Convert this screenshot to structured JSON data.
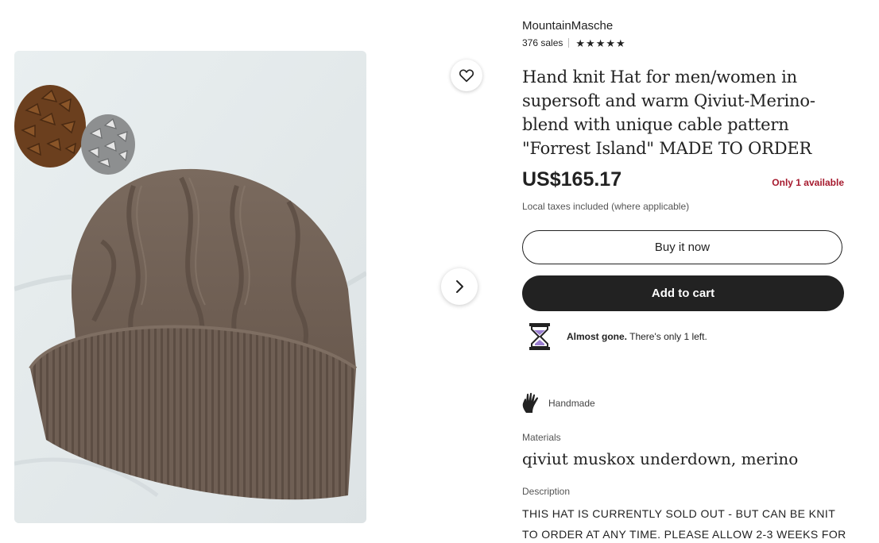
{
  "shop": {
    "name": "MountainMasche",
    "sales": "376 sales",
    "rating_stars": 5
  },
  "listing": {
    "title": "Hand knit Hat for men/women in supersoft and warm Qiviut-Merino-blend with unique cable pattern \"Forrest Island\" MADE TO ORDER",
    "price": "US$165.17",
    "availability": "Only 1 available",
    "tax_note": "Local taxes included (where applicable)"
  },
  "actions": {
    "buy_now_label": "Buy it now",
    "add_to_cart_label": "Add to cart",
    "favorite_icon": "heart-icon",
    "next_icon": "chevron-right-icon"
  },
  "scarcity": {
    "strong": "Almost gone.",
    "text": " There's only 1 left.",
    "icon": "hourglass-icon"
  },
  "highlights": {
    "handmade_label": "Handmade",
    "handmade_icon": "hand-icon"
  },
  "details": {
    "materials_label": "Materials",
    "materials_value": "qiviut muskox underdown, merino",
    "description_label": "Description",
    "description_text": "THIS HAT IS CURRENTLY SOLD OUT - BUT CAN BE KNIT TO ORDER AT ANY TIME. PLEASE ALLOW 2-3 WEEKS FOR"
  },
  "colors": {
    "text": "#222222",
    "availability": "#a61a2e",
    "cart_button": "#222222",
    "hourglass_sand": "#9b7fd1"
  }
}
